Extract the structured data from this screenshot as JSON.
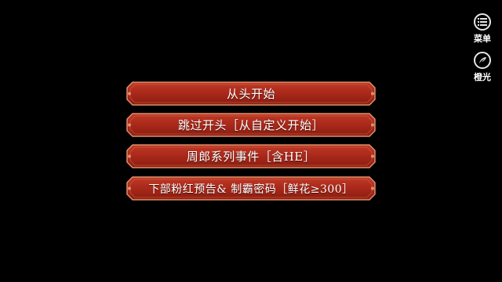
{
  "side_menu": {
    "menu_label": "菜单",
    "light_label": "橙光",
    "menu_icon": "list-icon",
    "light_icon": "orange-light-logo-icon"
  },
  "choices": [
    {
      "label": "从头开始"
    },
    {
      "label": "跳过开头［从自定义开始］"
    },
    {
      "label": "周郎系列事件［含HE］"
    },
    {
      "label": "下部粉红预告&  制霸密码［鲜花≥300］"
    }
  ],
  "colors": {
    "background": "#000000",
    "button_fill": "#a8281a",
    "button_border": "#e0906a"
  }
}
